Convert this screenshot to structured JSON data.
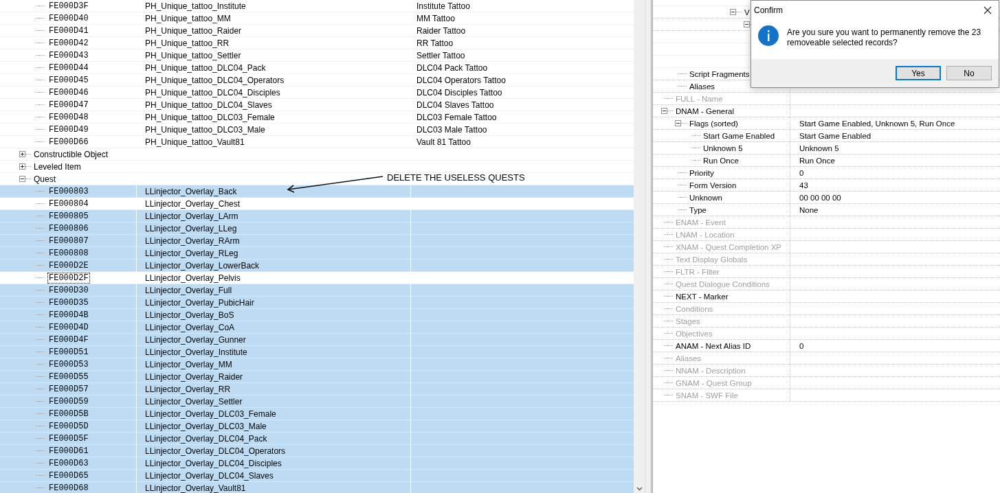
{
  "record_tree": {
    "nodes": [
      {
        "children": [
          {
            "form_id": "FE000D3F",
            "editor_id": "PH_Unique_tattoo_Institute",
            "name": "Institute Tattoo",
            "selected": false,
            "focused": false
          },
          {
            "form_id": "FE000D40",
            "editor_id": "PH_Unique_tattoo_MM",
            "name": "MM Tattoo",
            "selected": false,
            "focused": false
          },
          {
            "form_id": "FE000D41",
            "editor_id": "PH_Unique_tattoo_Raider",
            "name": "Raider Tattoo",
            "selected": false,
            "focused": false
          },
          {
            "form_id": "FE000D42",
            "editor_id": "PH_Unique_tattoo_RR",
            "name": "RR Tattoo",
            "selected": false,
            "focused": false
          },
          {
            "form_id": "FE000D43",
            "editor_id": "PH_Unique_tattoo_Settler",
            "name": "Settler Tattoo",
            "selected": false,
            "focused": false
          },
          {
            "form_id": "FE000D44",
            "editor_id": "PH_Unique_tattoo_DLC04_Pack",
            "name": "DLC04 Pack Tattoo",
            "selected": false,
            "focused": false
          },
          {
            "form_id": "FE000D45",
            "editor_id": "PH_Unique_tattoo_DLC04_Operators",
            "name": "DLC04 Operators Tattoo",
            "selected": false,
            "focused": false
          },
          {
            "form_id": "FE000D46",
            "editor_id": "PH_Unique_tattoo_DLC04_Disciples",
            "name": "DLC04 Disciples Tattoo",
            "selected": false,
            "focused": false
          },
          {
            "form_id": "FE000D47",
            "editor_id": "PH_Unique_tattoo_DLC04_Slaves",
            "name": "DLC04 Slaves Tattoo",
            "selected": false,
            "focused": false
          },
          {
            "form_id": "FE000D48",
            "editor_id": "PH_Unique_tattoo_DLC03_Female",
            "name": "DLC03 Female Tattoo",
            "selected": false,
            "focused": false
          },
          {
            "form_id": "FE000D49",
            "editor_id": "PH_Unique_tattoo_DLC03_Male",
            "name": "DLC03 Male Tattoo",
            "selected": false,
            "focused": false
          },
          {
            "form_id": "FE000D66",
            "editor_id": "PH_Unique_tattoo_Vault81",
            "name": "Vault 81 Tattoo",
            "selected": false,
            "focused": false
          }
        ]
      },
      {
        "label": "Constructible Object",
        "expanded": false
      },
      {
        "label": "Leveled Item",
        "expanded": false
      },
      {
        "label": "Quest",
        "expanded": true,
        "children": [
          {
            "form_id": "FE000803",
            "editor_id": "LLinjector_Overlay_Back",
            "selected": true,
            "focused": false
          },
          {
            "form_id": "FE000804",
            "editor_id": "LLinjector_Overlay_Chest",
            "selected": false,
            "focused": false
          },
          {
            "form_id": "FE000805",
            "editor_id": "LLinjector_Overlay_LArm",
            "selected": true,
            "focused": false
          },
          {
            "form_id": "FE000806",
            "editor_id": "LLinjector_Overlay_LLeg",
            "selected": true,
            "focused": false
          },
          {
            "form_id": "FE000807",
            "editor_id": "LLinjector_Overlay_RArm",
            "selected": true,
            "focused": false
          },
          {
            "form_id": "FE000808",
            "editor_id": "LLinjector_Overlay_RLeg",
            "selected": true,
            "focused": false
          },
          {
            "form_id": "FE000D2E",
            "editor_id": "LLinjector_Overlay_LowerBack",
            "selected": true,
            "focused": false
          },
          {
            "form_id": "FE000D2F",
            "editor_id": "LLinjector_Overlay_Pelvis",
            "selected": false,
            "focused": true
          },
          {
            "form_id": "FE000D30",
            "editor_id": "LLinjector_Overlay_Full",
            "selected": true,
            "focused": false
          },
          {
            "form_id": "FE000D35",
            "editor_id": "LLinjector_Overlay_PubicHair",
            "selected": true,
            "focused": false
          },
          {
            "form_id": "FE000D4B",
            "editor_id": "LLinjector_Overlay_BoS",
            "selected": true,
            "focused": false
          },
          {
            "form_id": "FE000D4D",
            "editor_id": "LLinjector_Overlay_CoA",
            "selected": true,
            "focused": false
          },
          {
            "form_id": "FE000D4F",
            "editor_id": "LLinjector_Overlay_Gunner",
            "selected": true,
            "focused": false
          },
          {
            "form_id": "FE000D51",
            "editor_id": "LLinjector_Overlay_Institute",
            "selected": true,
            "focused": false
          },
          {
            "form_id": "FE000D53",
            "editor_id": "LLinjector_Overlay_MM",
            "selected": true,
            "focused": false
          },
          {
            "form_id": "FE000D55",
            "editor_id": "LLinjector_Overlay_Raider",
            "selected": true,
            "focused": false
          },
          {
            "form_id": "FE000D57",
            "editor_id": "LLinjector_Overlay_RR",
            "selected": true,
            "focused": false
          },
          {
            "form_id": "FE000D59",
            "editor_id": "LLinjector_Overlay_Settler",
            "selected": true,
            "focused": false
          },
          {
            "form_id": "FE000D5B",
            "editor_id": "LLinjector_Overlay_DLC03_Female",
            "selected": true,
            "focused": false
          },
          {
            "form_id": "FE000D5D",
            "editor_id": "LLinjector_Overlay_DLC03_Male",
            "selected": true,
            "focused": false
          },
          {
            "form_id": "FE000D5F",
            "editor_id": "LLinjector_Overlay_DLC04_Pack",
            "selected": true,
            "focused": false
          },
          {
            "form_id": "FE000D61",
            "editor_id": "LLinjector_Overlay_DLC04_Operators",
            "selected": true,
            "focused": false
          },
          {
            "form_id": "FE000D63",
            "editor_id": "LLinjector_Overlay_DLC04_Disciples",
            "selected": true,
            "focused": false
          },
          {
            "form_id": "FE000D65",
            "editor_id": "LLinjector_Overlay_DLC04_Slaves",
            "selected": true,
            "focused": false
          },
          {
            "form_id": "FE000D68",
            "editor_id": "LLinjector_Overlay_Vault81",
            "selected": true,
            "focused": false
          }
        ]
      }
    ]
  },
  "annotation": {
    "text": "DELETE THE USELESS QUESTS"
  },
  "record_view": {
    "partial_branch": {
      "children": [
        {
          "children": [
            {
              "children": [
                {
                  "children": [
                    {
                      "children": [
                        {
                          "label": "V",
                          "expanded": true,
                          "children": [
                            {
                              "expanded": true
                            }
                          ]
                        }
                      ]
                    }
                  ]
                }
              ]
            }
          ]
        },
        {
          "label": "Script Fragments"
        },
        {
          "label": "Aliases"
        }
      ]
    },
    "fields": [
      {
        "label": "FULL - Name",
        "disabled": true
      },
      {
        "label": "DNAM - General",
        "disabled": false,
        "expanded": true,
        "children": [
          {
            "label": "Flags (sorted)",
            "value": "Start Game Enabled, Unknown 5, Run Once",
            "expanded": true,
            "children": [
              {
                "label": "Start Game Enabled",
                "value": "Start Game Enabled"
              },
              {
                "label": "Unknown 5",
                "value": "Unknown 5"
              },
              {
                "label": "Run Once",
                "value": "Run Once"
              }
            ]
          },
          {
            "label": "Priority",
            "value": "0"
          },
          {
            "label": "Form Version",
            "value": "43"
          },
          {
            "label": "Unknown",
            "value": "00 00 00 00"
          },
          {
            "label": "Type",
            "value": "None"
          }
        ]
      },
      {
        "label": "ENAM - Event",
        "disabled": true
      },
      {
        "label": "LNAM - Location",
        "disabled": true
      },
      {
        "label": "XNAM - Quest Completion XP",
        "disabled": true
      },
      {
        "label": "Text Display Globals",
        "disabled": true
      },
      {
        "label": "FLTR - Filter",
        "disabled": true
      },
      {
        "label": "Quest Dialogue Conditions",
        "disabled": true
      },
      {
        "label": "NEXT - Marker",
        "disabled": false
      },
      {
        "label": "Conditions",
        "disabled": true
      },
      {
        "label": "Stages",
        "disabled": true
      },
      {
        "label": "Objectives",
        "disabled": true
      },
      {
        "label": "ANAM - Next Alias ID",
        "disabled": false,
        "value": "0"
      },
      {
        "label": "Aliases",
        "disabled": true
      },
      {
        "label": "NNAM - Description",
        "disabled": true
      },
      {
        "label": "GNAM - Quest Group",
        "disabled": true
      },
      {
        "label": "SNAM - SWF File",
        "disabled": true
      }
    ]
  },
  "dialog": {
    "title": "Confirm",
    "message": "Are you sure you want to permanently remove the 23 removeable selected records?",
    "buttons": [
      {
        "label": "Yes",
        "default": true
      },
      {
        "label": "No",
        "default": false
      }
    ]
  }
}
